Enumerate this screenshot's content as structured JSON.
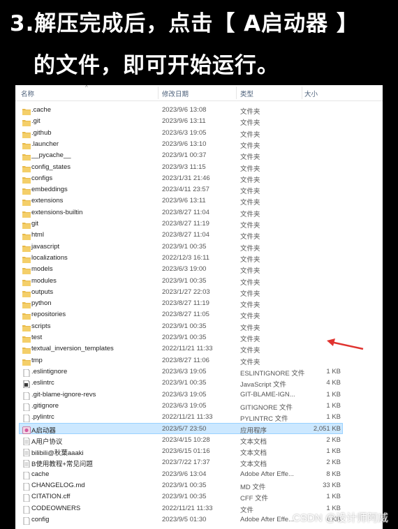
{
  "banner": {
    "line1": "3.解压完成后，点击【 A启动器 】",
    "line2": "的文件，即可开始运行。"
  },
  "columns": {
    "name": "名称",
    "date": "修改日期",
    "type": "类型",
    "size": "大小"
  },
  "files": [
    {
      "icon": "folder",
      "name": ".cache",
      "date": "2023/9/6 13:08",
      "type": "文件夹",
      "size": ""
    },
    {
      "icon": "folder",
      "name": ".git",
      "date": "2023/9/6 13:11",
      "type": "文件夹",
      "size": ""
    },
    {
      "icon": "folder",
      "name": ".github",
      "date": "2023/6/3 19:05",
      "type": "文件夹",
      "size": ""
    },
    {
      "icon": "folder",
      "name": ".launcher",
      "date": "2023/9/6 13:10",
      "type": "文件夹",
      "size": ""
    },
    {
      "icon": "folder",
      "name": "__pycache__",
      "date": "2023/9/1 00:37",
      "type": "文件夹",
      "size": ""
    },
    {
      "icon": "folder",
      "name": "config_states",
      "date": "2023/9/3 11:15",
      "type": "文件夹",
      "size": ""
    },
    {
      "icon": "folder",
      "name": "configs",
      "date": "2023/1/31 21:46",
      "type": "文件夹",
      "size": ""
    },
    {
      "icon": "folder",
      "name": "embeddings",
      "date": "2023/4/11 23:57",
      "type": "文件夹",
      "size": ""
    },
    {
      "icon": "folder",
      "name": "extensions",
      "date": "2023/9/6 13:11",
      "type": "文件夹",
      "size": ""
    },
    {
      "icon": "folder",
      "name": "extensions-builtin",
      "date": "2023/8/27 11:04",
      "type": "文件夹",
      "size": ""
    },
    {
      "icon": "folder",
      "name": "git",
      "date": "2023/8/27 11:19",
      "type": "文件夹",
      "size": ""
    },
    {
      "icon": "folder",
      "name": "html",
      "date": "2023/8/27 11:04",
      "type": "文件夹",
      "size": ""
    },
    {
      "icon": "folder",
      "name": "javascript",
      "date": "2023/9/1 00:35",
      "type": "文件夹",
      "size": ""
    },
    {
      "icon": "folder",
      "name": "localizations",
      "date": "2022/12/3 16:11",
      "type": "文件夹",
      "size": ""
    },
    {
      "icon": "folder",
      "name": "models",
      "date": "2023/6/3 19:00",
      "type": "文件夹",
      "size": ""
    },
    {
      "icon": "folder",
      "name": "modules",
      "date": "2023/9/1 00:35",
      "type": "文件夹",
      "size": ""
    },
    {
      "icon": "folder",
      "name": "outputs",
      "date": "2023/1/27 22:03",
      "type": "文件夹",
      "size": ""
    },
    {
      "icon": "folder",
      "name": "python",
      "date": "2023/8/27 11:19",
      "type": "文件夹",
      "size": ""
    },
    {
      "icon": "folder",
      "name": "repositories",
      "date": "2023/8/27 11:05",
      "type": "文件夹",
      "size": ""
    },
    {
      "icon": "folder",
      "name": "scripts",
      "date": "2023/9/1 00:35",
      "type": "文件夹",
      "size": ""
    },
    {
      "icon": "folder",
      "name": "test",
      "date": "2023/9/1 00:35",
      "type": "文件夹",
      "size": ""
    },
    {
      "icon": "folder",
      "name": "textual_inversion_templates",
      "date": "2022/11/21 11:33",
      "type": "文件夹",
      "size": ""
    },
    {
      "icon": "folder",
      "name": "tmp",
      "date": "2023/8/27 11:06",
      "type": "文件夹",
      "size": ""
    },
    {
      "icon": "file",
      "name": ".eslintignore",
      "date": "2023/6/3 19:05",
      "type": "ESLINTIGNORE 文件",
      "size": "1 KB"
    },
    {
      "icon": "js-file",
      "name": ".eslintrc",
      "date": "2023/9/1 00:35",
      "type": "JavaScript 文件",
      "size": "4 KB"
    },
    {
      "icon": "file",
      "name": ".git-blame-ignore-revs",
      "date": "2023/6/3 19:05",
      "type": "GIT-BLAME-IGN...",
      "size": "1 KB"
    },
    {
      "icon": "file",
      "name": ".gitignore",
      "date": "2023/6/3 19:05",
      "type": "GITIGNORE 文件",
      "size": "1 KB"
    },
    {
      "icon": "file",
      "name": ".pylintrc",
      "date": "2022/11/21 11:33",
      "type": "PYLINTRC 文件",
      "size": "1 KB"
    },
    {
      "icon": "app",
      "name": "A启动器",
      "date": "2023/5/7 23:50",
      "type": "应用程序",
      "size": "2,051 KB",
      "selected": true
    },
    {
      "icon": "doc",
      "name": "A用户协议",
      "date": "2023/4/15 10:28",
      "type": "文本文档",
      "size": "2 KB"
    },
    {
      "icon": "doc",
      "name": "bilibili@秋葉aaaki",
      "date": "2023/6/15 01:16",
      "type": "文本文档",
      "size": "1 KB"
    },
    {
      "icon": "doc",
      "name": "B使用教程+常见问题",
      "date": "2023/7/22 17:37",
      "type": "文本文档",
      "size": "2 KB"
    },
    {
      "icon": "file",
      "name": "cache",
      "date": "2023/9/6 13:04",
      "type": "Adobe After Effe...",
      "size": "8 KB"
    },
    {
      "icon": "file",
      "name": "CHANGELOG.md",
      "date": "2023/9/1 00:35",
      "type": "MD 文件",
      "size": "33 KB"
    },
    {
      "icon": "file",
      "name": "CITATION.cff",
      "date": "2023/9/1 00:35",
      "type": "CFF 文件",
      "size": "1 KB"
    },
    {
      "icon": "file",
      "name": "CODEOWNERS",
      "date": "2022/11/21 11:33",
      "type": "文件",
      "size": "1 KB"
    },
    {
      "icon": "file",
      "name": "config",
      "date": "2023/9/5 01:30",
      "type": "Adobe After Effe...",
      "size": "4 KB"
    }
  ],
  "watermark": "CSDN @设计师阿威",
  "colors": {
    "folder": "#e8b94a",
    "selected_bg": "#cce8ff",
    "arrow": "#e0332f"
  }
}
